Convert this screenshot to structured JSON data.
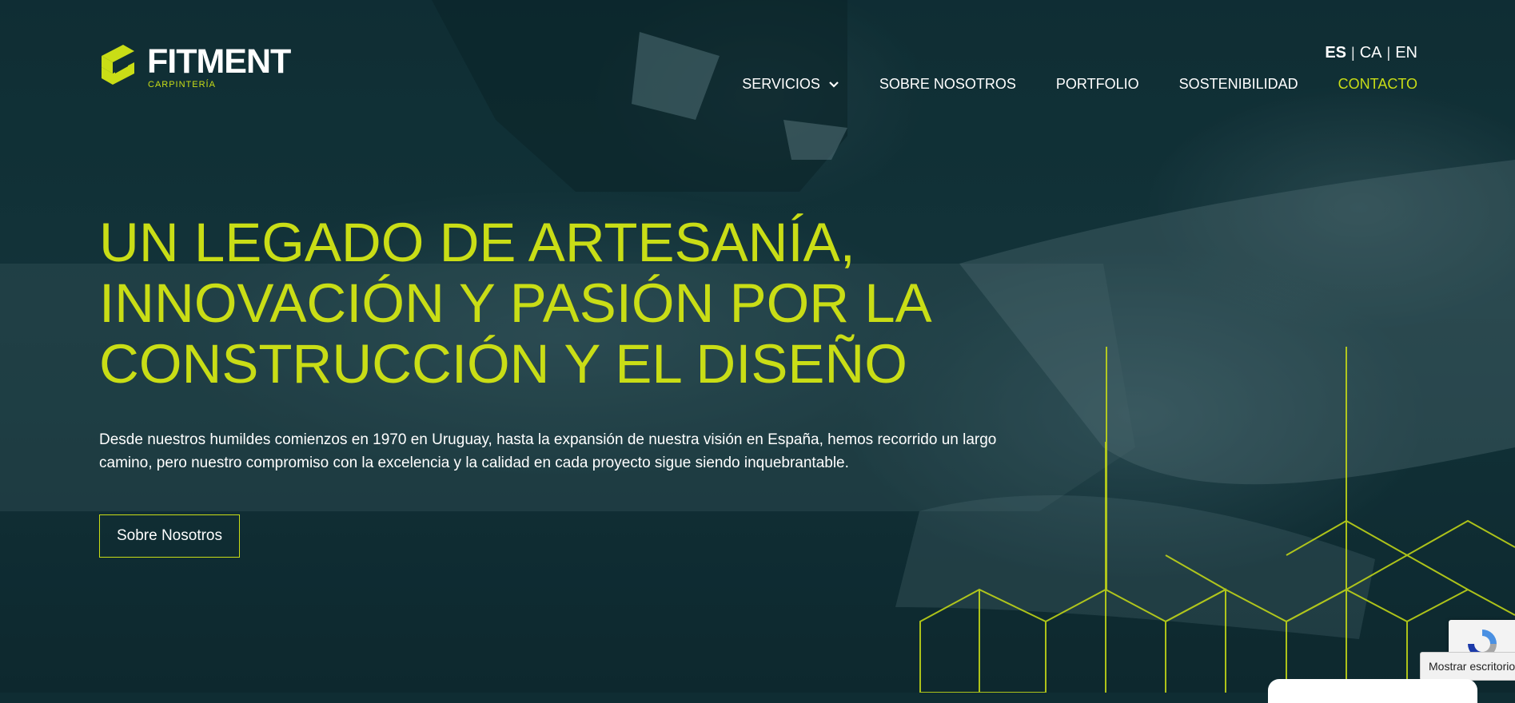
{
  "brand": {
    "name": "FITMENT",
    "tagline": "CARPINTERÍA",
    "accent_color": "#c9dd16",
    "background_color": "#0f2d33"
  },
  "languages": {
    "items": [
      "ES",
      "CA",
      "EN"
    ],
    "active": "ES"
  },
  "nav": {
    "items": [
      {
        "label": "SERVICIOS",
        "has_dropdown": true
      },
      {
        "label": "SOBRE NOSOTROS"
      },
      {
        "label": "PORTFOLIO"
      },
      {
        "label": "SOSTENIBILIDAD"
      },
      {
        "label": "CONTACTO",
        "accent": true
      }
    ]
  },
  "hero": {
    "headline_lines": [
      "UN LEGADO DE ARTESANÍA,",
      "INNOVACIÓN Y PASIÓN POR LA",
      "CONSTRUCCIÓN Y EL DISEÑO"
    ],
    "intro": "Desde nuestros humildes comienzos en 1970 en Uruguay, hasta la expansión de nuestra visión en España, hemos recorrido un largo camino, pero nuestro compromiso con la excelencia y la calidad en cada proyecto sigue siendo inquebrantable.",
    "cta_label": "Sobre Nosotros"
  },
  "widgets": {
    "recaptcha_icon": "recaptcha-icon",
    "tooltip_text": "Mostrar escritorio"
  },
  "icons": {
    "dropdown": "chevron-down-icon",
    "logo": "fitment-logo-mark"
  }
}
